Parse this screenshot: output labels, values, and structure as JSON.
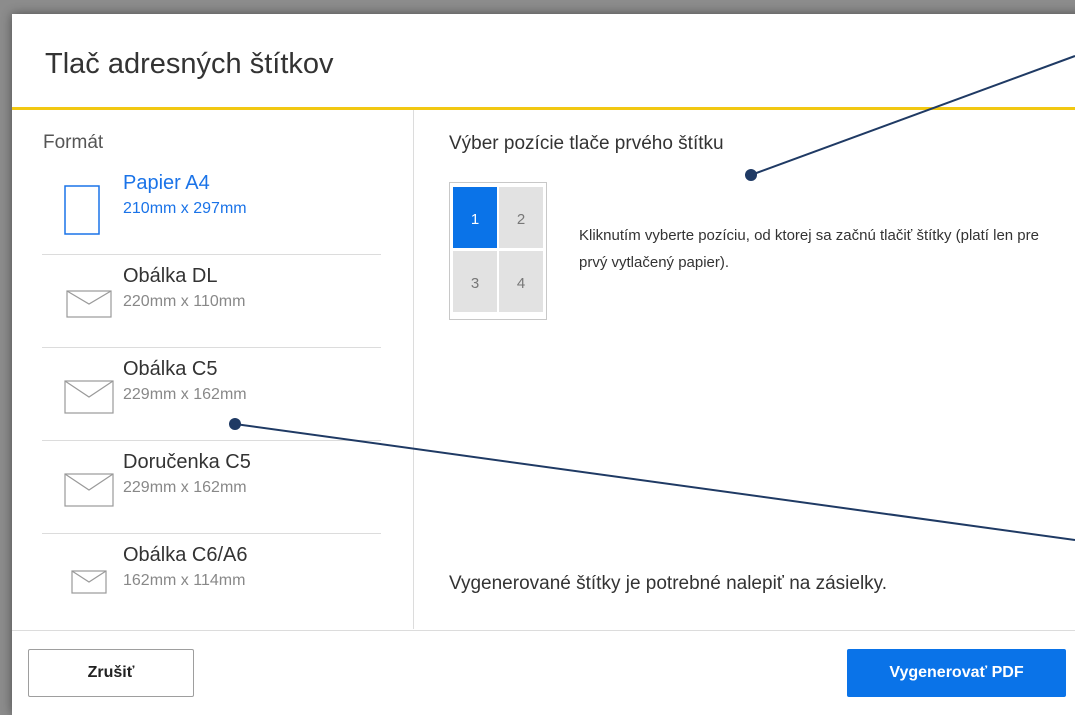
{
  "dialog": {
    "title": "Tlač adresných štítkov"
  },
  "format": {
    "label": "Formát",
    "items": [
      {
        "name": "Papier A4",
        "size": "210mm x 297mm",
        "icon": "page-icon",
        "active": true
      },
      {
        "name": "Obálka DL",
        "size": "220mm x 110mm",
        "icon": "envelope-icon",
        "active": false
      },
      {
        "name": "Obálka C5",
        "size": "229mm x 162mm",
        "icon": "envelope-icon",
        "active": false
      },
      {
        "name": "Doručenka C5",
        "size": "229mm x 162mm",
        "icon": "envelope-icon",
        "active": false
      },
      {
        "name": "Obálka C6/A6",
        "size": "162mm x 114mm",
        "icon": "envelope-icon",
        "active": false
      }
    ]
  },
  "position": {
    "title": "Výber pozície tlače prvého štítku",
    "cells": [
      "1",
      "2",
      "3",
      "4"
    ],
    "selected": "1",
    "hint": "Kliknutím vyberte pozíciu, od ktorej sa začnú tlačiť štítky (platí len pre prvý vytlačený papier).",
    "note": "Vygenerované štítky je potrebné nalepiť na zásielky."
  },
  "footer": {
    "cancel_label": "Zrušiť",
    "generate_label": "Vygenerovať PDF"
  },
  "colors": {
    "accent": "#0a73e8",
    "divider_yellow": "#f2c811",
    "annotation_line": "#1f3a64"
  }
}
